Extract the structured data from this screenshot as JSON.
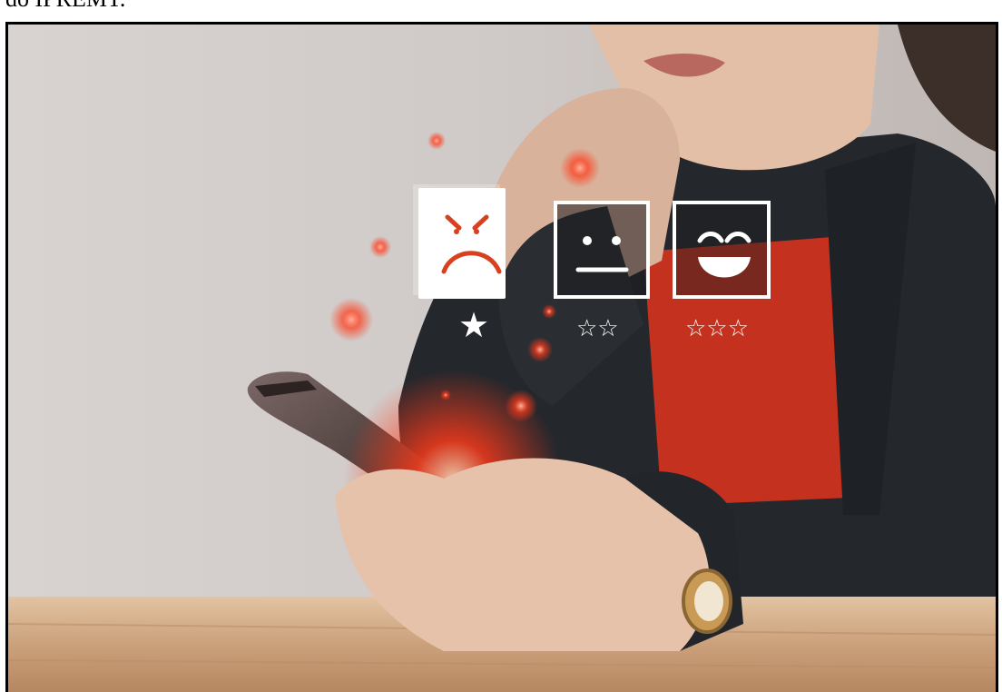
{
  "caption": {
    "fragment": "do IPREMT."
  },
  "photo": {
    "subject": "rating-feedback-photo",
    "rating_options": [
      {
        "name": "angry",
        "stars": "★",
        "selected": true
      },
      {
        "name": "neutral",
        "stars": "☆☆",
        "selected": false
      },
      {
        "name": "happy",
        "stars": "☆☆☆",
        "selected": false
      }
    ],
    "colors": {
      "wall": "#d4cfcd",
      "table": "#cfa47c",
      "jacket": "#26292e",
      "shirt": "#c8331f",
      "skin": "#e8c6b0",
      "glow": "#ff3a1a",
      "phone": "#5a4a48"
    }
  }
}
